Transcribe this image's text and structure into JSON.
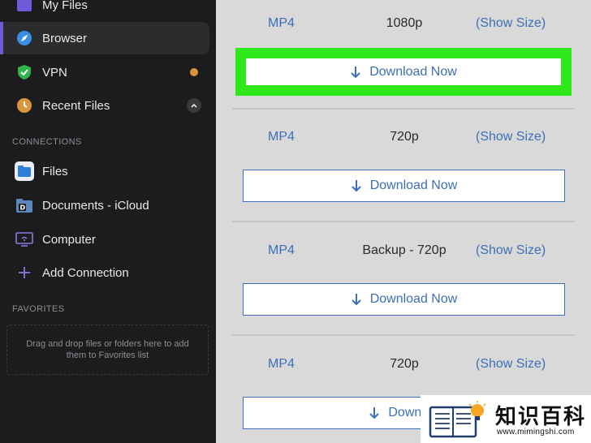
{
  "sidebar": {
    "items": [
      {
        "label": "My Files",
        "icon": "folder-purple-icon"
      },
      {
        "label": "Browser",
        "icon": "compass-icon"
      },
      {
        "label": "VPN",
        "icon": "shield-check-icon"
      },
      {
        "label": "Recent Files",
        "icon": "clock-icon"
      }
    ],
    "connections_label": "CONNECTIONS",
    "connections": [
      {
        "label": "Files",
        "icon": "files-app-icon"
      },
      {
        "label": "Documents - iCloud",
        "icon": "documents-folder-icon"
      },
      {
        "label": "Computer",
        "icon": "computer-icon"
      },
      {
        "label": "Add Connection",
        "icon": "plus-icon"
      }
    ],
    "favorites_label": "FAVORITES",
    "favorites_hint": "Drag and drop files or folders here to add them to Favorites list"
  },
  "downloads": [
    {
      "format": "MP4",
      "resolution": "1080p",
      "size_label": "(Show Size)",
      "button": "Download Now"
    },
    {
      "format": "MP4",
      "resolution": "720p",
      "size_label": "(Show Size)",
      "button": "Download Now"
    },
    {
      "format": "MP4",
      "resolution": "Backup - 720p",
      "size_label": "(Show Size)",
      "button": "Download Now"
    },
    {
      "format": "MP4",
      "resolution": "720p",
      "size_label": "(Show Size)",
      "button": "Downloa"
    }
  ],
  "watermark": {
    "title": "知识百科",
    "url": "www.mimingshi.com"
  },
  "colors": {
    "accent": "#6e5bd8",
    "link": "#3c6fb8",
    "highlight": "#2ee81a",
    "vpn_dot": "#d9953b"
  }
}
